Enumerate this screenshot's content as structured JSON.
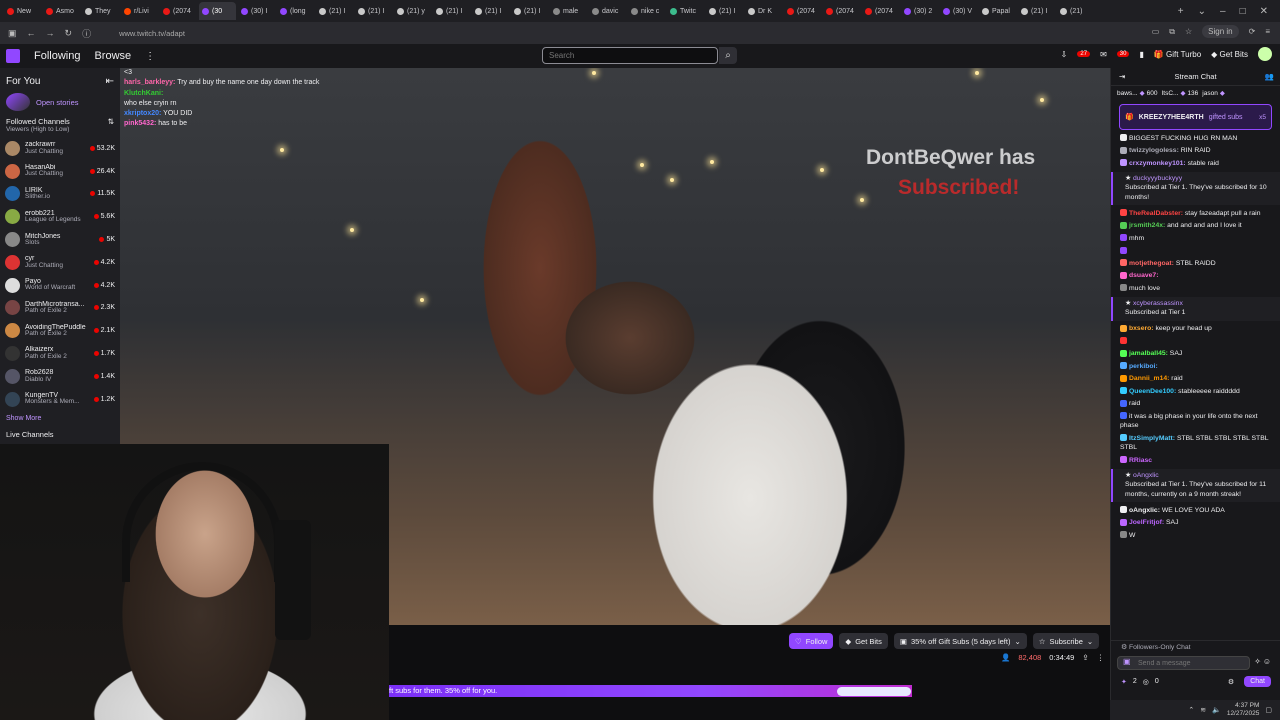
{
  "browser": {
    "tabs": [
      {
        "label": "New",
        "color": "#e91916"
      },
      {
        "label": "Asmo",
        "color": "#e91916"
      },
      {
        "label": "They",
        "color": "#c9c9c9"
      },
      {
        "label": "r/Livi",
        "color": "#ff4500"
      },
      {
        "label": "(2074",
        "color": "#e91916"
      },
      {
        "label": "(30",
        "color": "#9147ff",
        "active": true
      },
      {
        "label": "(30) I",
        "color": "#9147ff"
      },
      {
        "label": "(long",
        "color": "#9147ff"
      },
      {
        "label": "(21) I",
        "color": "#c9c9c9"
      },
      {
        "label": "(21) I",
        "color": "#c9c9c9"
      },
      {
        "label": "(21) y",
        "color": "#c9c9c9"
      },
      {
        "label": "(21) I",
        "color": "#c9c9c9"
      },
      {
        "label": "(21) I",
        "color": "#c9c9c9"
      },
      {
        "label": "(21) I",
        "color": "#c9c9c9"
      },
      {
        "label": "male",
        "color": "#8a8a8a"
      },
      {
        "label": "davic",
        "color": "#8a8a8a"
      },
      {
        "label": "nike c",
        "color": "#8a8a8a"
      },
      {
        "label": "Twitc",
        "color": "#3cbc8d"
      },
      {
        "label": "(21) I",
        "color": "#c9c9c9"
      },
      {
        "label": "Dr K",
        "color": "#c9c9c9"
      },
      {
        "label": "(2074",
        "color": "#e91916"
      },
      {
        "label": "(2074",
        "color": "#e91916"
      },
      {
        "label": "(2074",
        "color": "#e91916"
      },
      {
        "label": "(30) 2",
        "color": "#9147ff"
      },
      {
        "label": "(30) V",
        "color": "#9147ff"
      },
      {
        "label": "Papal",
        "color": "#c9c9c9"
      },
      {
        "label": "(21) I",
        "color": "#c9c9c9"
      },
      {
        "label": "(21)",
        "color": "#c9c9c9"
      }
    ],
    "url": "www.twitch.tv/adapt",
    "signin": "Sign in"
  },
  "nav": {
    "following": "Following",
    "browse": "Browse",
    "search_placeholder": "Search",
    "notif_count_1": "27",
    "notif_count_2": "30",
    "gift_turbo": "Gift Turbo",
    "get_bits": "Get Bits"
  },
  "sidebar": {
    "for_you": "For You",
    "open_stories": "Open stories",
    "followed_title": "Followed Channels",
    "followed_sort": "Viewers (High to Low)",
    "channels": [
      {
        "name": "zackrawrr",
        "game": "Just Chatting",
        "viewers": "53.2K",
        "color": "#a86"
      },
      {
        "name": "HasanAbi",
        "game": "Just Chatting",
        "viewers": "26.4K",
        "color": "#c64"
      },
      {
        "name": "LIRIK",
        "game": "Slither.io",
        "viewers": "11.5K",
        "color": "#26a"
      },
      {
        "name": "erobb221",
        "game": "League of Legends",
        "viewers": "5.6K",
        "color": "#8a4"
      },
      {
        "name": "MitchJones",
        "game": "Slots",
        "viewers": "5K",
        "color": "#888"
      },
      {
        "name": "cyr",
        "game": "Just Chatting",
        "viewers": "4.2K",
        "color": "#d33"
      },
      {
        "name": "Payo",
        "game": "World of Warcraft",
        "viewers": "4.2K",
        "color": "#ddd"
      },
      {
        "name": "DarthMicrotransa...",
        "game": "Path of Exile 2",
        "viewers": "2.3K",
        "color": "#744"
      },
      {
        "name": "AvoidingThePuddle",
        "game": "Path of Exile 2",
        "viewers": "2.1K",
        "color": "#c84"
      },
      {
        "name": "Alkaizerx",
        "game": "Path of Exile 2",
        "viewers": "1.7K",
        "color": "#333"
      },
      {
        "name": "Rob2628",
        "game": "Diablo IV",
        "viewers": "1.4K",
        "color": "#556"
      },
      {
        "name": "KungenTV",
        "game": "Monsters & Mem...",
        "viewers": "1.2K",
        "color": "#345"
      }
    ],
    "show_more": "Show More",
    "live_channels": "Live Channels"
  },
  "video": {
    "overlay_name": "DontBeQwer has",
    "overlay_sub": "Subscribed!",
    "chat": [
      {
        "user": "",
        "text": "",
        "color": "#bbb"
      },
      {
        "user": "",
        "text": "<3",
        "color": "#5cf"
      },
      {
        "user": "harls_barkleyy:",
        "text": " Try and buy the name one day down the track",
        "color": "#f6a"
      },
      {
        "user": "KlutchKani:",
        "text": "",
        "color": "#3c3"
      },
      {
        "user": "",
        "text": "who else cryin rn",
        "color": "#f60"
      },
      {
        "user": "",
        "text": "",
        "color": "#f33"
      },
      {
        "user": "xkriptox20:",
        "text": " YOU DID",
        "color": "#48f"
      },
      {
        "user": "",
        "text": "",
        "color": "#b6f"
      },
      {
        "user": "pink5432:",
        "text": " has to be",
        "color": "#f6c"
      }
    ]
  },
  "infobar": {
    "follow": "Follow",
    "get_bits": "Get Bits",
    "gift_subs": "35% off Gift Subs (5 days left)",
    "subscribe": "Subscribe",
    "viewers": "82,408",
    "uptime": "0:34:49",
    "promo": "ft subs for them. 35% off for you."
  },
  "chat": {
    "title": "Stream Chat",
    "bits_leaders": [
      {
        "name": "baws...",
        "amount": "600"
      },
      {
        "name": "ItsC...",
        "amount": "136"
      },
      {
        "name": "jason",
        "amount": ""
      }
    ],
    "pinned": {
      "user": "KREEZY7HEE4RTH",
      "text": "gifted subs",
      "count": "x5"
    },
    "messages": [
      {
        "type": "msg",
        "user": "",
        "text": "BIGGEST FUCKING HUG RN MAN",
        "color": "#efeff1"
      },
      {
        "type": "msg",
        "user": "twizzylogoless:",
        "text": " RIN RAID",
        "color": "#adadb8"
      },
      {
        "type": "msg",
        "user": "crxzymonkey101:",
        "text": " stable raid",
        "color": "#bf94ff"
      },
      {
        "type": "sub",
        "user": "duckyyybuckyyy",
        "text": "Subscribed at Tier 1. They've subscribed for 10 months!"
      },
      {
        "type": "msg",
        "user": "TheRealDabster:",
        "text": " stay fazeadapt pull a rain",
        "color": "#f44"
      },
      {
        "type": "msg",
        "user": "jrsmith24x:",
        "text": " and and and and I love it",
        "color": "#5c5"
      },
      {
        "type": "msg",
        "user": "",
        "text": "mhm",
        "color": "#9147ff"
      },
      {
        "type": "msg",
        "user": "",
        "text": "",
        "color": "#9147ff"
      },
      {
        "type": "msg",
        "user": "motjethegoat:",
        "text": " STBL RAIDD",
        "color": "#f66"
      },
      {
        "type": "msg",
        "user": "dsuave7:",
        "text": "",
        "color": "#f6c"
      },
      {
        "type": "msg",
        "user": "",
        "text": "much love",
        "color": "#888"
      },
      {
        "type": "sub",
        "user": "xcyberassassinx",
        "text": "Subscribed at Tier 1"
      },
      {
        "type": "msg",
        "user": "bxsero:",
        "text": " keep your head up",
        "color": "#fa3"
      },
      {
        "type": "msg",
        "user": "",
        "text": "",
        "color": "#f33"
      },
      {
        "type": "msg",
        "user": "jamalball45:",
        "text": " SAJ",
        "color": "#5f5"
      },
      {
        "type": "msg",
        "user": "perkiboi:",
        "text": "",
        "color": "#5af"
      },
      {
        "type": "msg",
        "user": "Dannii_m14:",
        "text": " raid",
        "color": "#f90"
      },
      {
        "type": "msg",
        "user": "QueenDee100:",
        "text": " stableeeee raiddddd",
        "color": "#3cf"
      },
      {
        "type": "msg",
        "user": "",
        "text": "raid",
        "color": "#46f"
      },
      {
        "type": "msg",
        "user": "",
        "text": "it was a big phase in your life onto the next phase",
        "color": "#46f"
      },
      {
        "type": "msg",
        "user": "ItzSimplyMatt:",
        "text": " STBL STBL STBL STBL STBL STBL",
        "color": "#5cf"
      },
      {
        "type": "msg",
        "user": "RRiasc",
        "text": "",
        "color": "#c6f"
      },
      {
        "type": "sub",
        "user": "oAngxlic",
        "text": "Subscribed at Tier 1. They've subscribed for 11 months, currently on a 9 month streak!"
      },
      {
        "type": "msg",
        "user": "oAngxlic:",
        "text": " WE LOVE YOU ADA",
        "color": "#efeff1"
      },
      {
        "type": "msg",
        "user": "JoelFritjof:",
        "text": " SAJ",
        "color": "#b6f"
      },
      {
        "type": "msg",
        "user": "",
        "text": "W",
        "color": "#888"
      }
    ],
    "followers_only": "Followers-Only Chat",
    "send_placeholder": "Send a message",
    "points": "2",
    "points2": "0",
    "chat_button": "Chat"
  },
  "taskbar": {
    "time": "4:37 PM",
    "date": "12/27/2025"
  }
}
